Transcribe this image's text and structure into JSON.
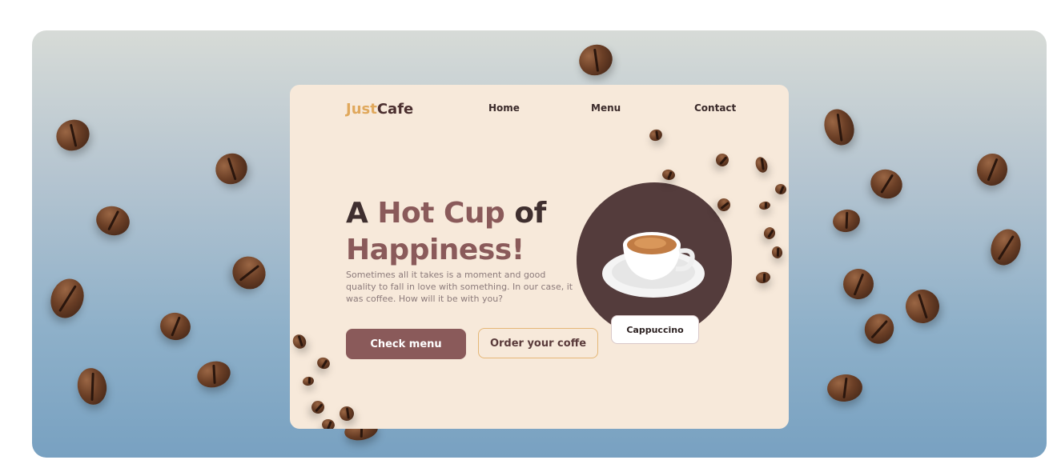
{
  "brand": {
    "part1": "Just",
    "part2": "Cafe",
    "accent_color": "#e0a85c",
    "dark_color": "#4b2f2f"
  },
  "nav": {
    "items": [
      "Home",
      "Menu",
      "Contact"
    ]
  },
  "hero": {
    "title_line1_a": "A ",
    "title_line1_b": "Hot Cup",
    "title_line1_c": " of",
    "title_line2": "Happiness!",
    "description": "Sometimes all it takes is a moment and good quality to fall in love with something. In our case, it was coffee. How will it be with you?",
    "primary_button": "Check menu",
    "secondary_button": "Order your coffe"
  },
  "product": {
    "label": "Cappuccino",
    "icon": "coffee-cup-icon"
  },
  "colors": {
    "card_bg": "#f7e9da",
    "primary": "#8a5a5a",
    "circle": "#543c3c",
    "outline": "#e5b777"
  }
}
